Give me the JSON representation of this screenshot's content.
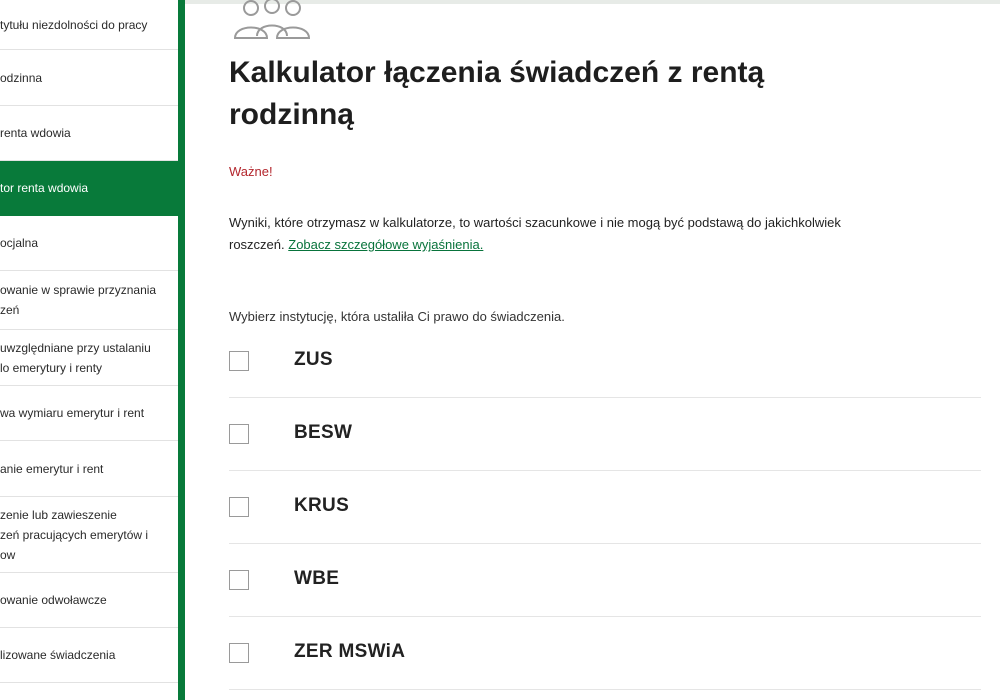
{
  "sidebar": {
    "items": [
      {
        "label": "tytułu niezdolności do pracy",
        "active": false
      },
      {
        "label": "odzinna",
        "active": false
      },
      {
        "label": "renta wdowia",
        "active": false
      },
      {
        "label": "tor renta wdowia",
        "active": true
      },
      {
        "label": "ocjalna",
        "active": false
      },
      {
        "label": "owanie w sprawie przyznania\nzeń",
        "active": false
      },
      {
        "label": "uwzględniane przy ustalaniu\nlo emerytury i renty",
        "active": false
      },
      {
        "label": "wa wymiaru emerytur i rent",
        "active": false
      },
      {
        "label": "anie emerytur i rent",
        "active": false
      },
      {
        "label": "zenie lub zawieszenie\nzeń pracujących emerytów i\now",
        "active": false
      },
      {
        "label": "owanie odwoławcze",
        "active": false
      },
      {
        "label": "lizowane świadczenia",
        "active": false
      },
      {
        "label": "",
        "active": false
      }
    ]
  },
  "main": {
    "icon": "people-group-icon",
    "title": "Kalkulator łączenia świadczeń z rentą rodzinną",
    "important_label": "Ważne!",
    "disclaimer_text": "Wyniki, które otrzymasz w kalkulatorze, to wartości szacunkowe i nie mogą być podstawą do jakichkolwiek roszczeń. ",
    "disclaimer_link": "Zobacz szczegółowe wyjaśnienia.",
    "choose_prompt": "Wybierz instytucję, która ustaliła Ci prawo do świadczenia.",
    "institutions": [
      "ZUS",
      "BESW",
      "KRUS",
      "WBE",
      "ZER MSWiA"
    ]
  },
  "colors": {
    "brand_green": "#087a3a",
    "important_red": "#b3262d",
    "link_green": "#08733b"
  }
}
